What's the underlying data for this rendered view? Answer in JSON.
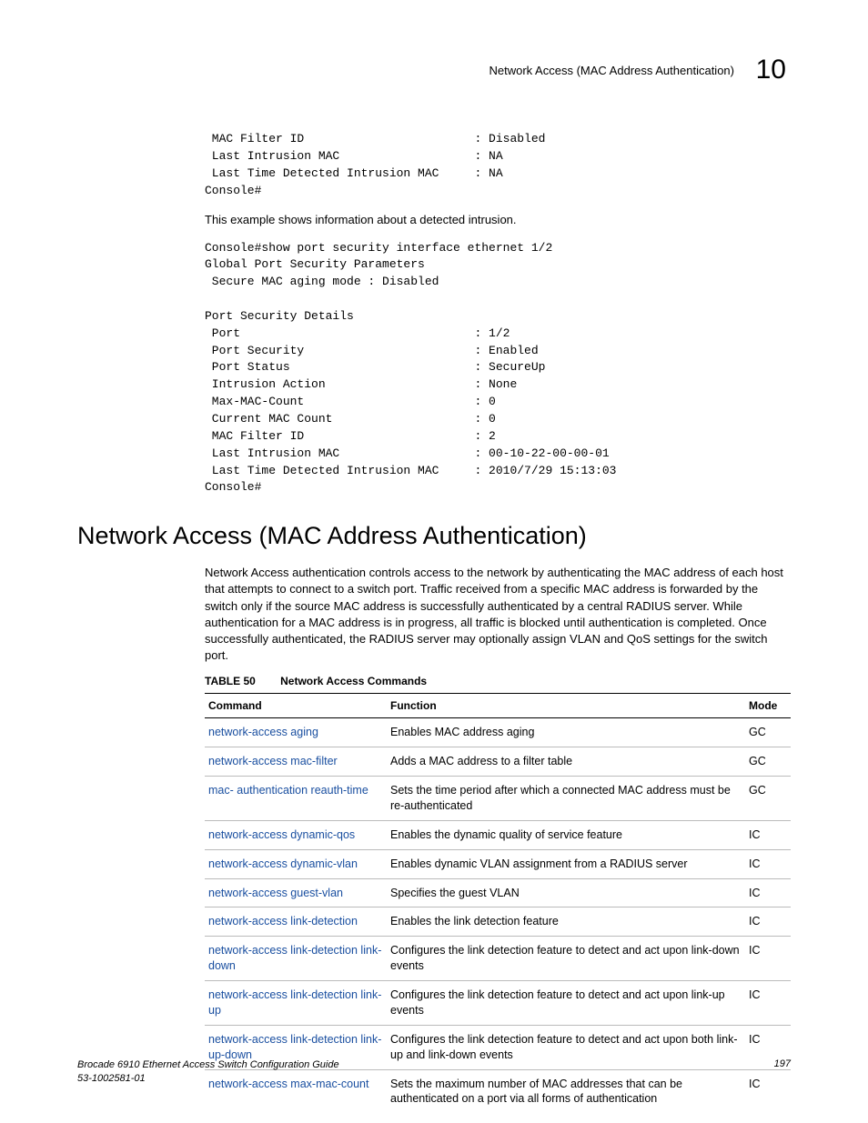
{
  "header": {
    "title": "Network Access (MAC Address Authentication)",
    "chapter_number": "10"
  },
  "code_block_1": " MAC Filter ID                        : Disabled\n Last Intrusion MAC                   : NA\n Last Time Detected Intrusion MAC     : NA\nConsole#",
  "example_intro": "This example shows information about a detected intrusion.",
  "code_block_2": "Console#show port security interface ethernet 1/2\nGlobal Port Security Parameters\n Secure MAC aging mode : Disabled\n\nPort Security Details\n Port                                 : 1/2\n Port Security                        : Enabled\n Port Status                          : SecureUp\n Intrusion Action                     : None\n Max-MAC-Count                        : 0\n Current MAC Count                    : 0\n MAC Filter ID                        : 2\n Last Intrusion MAC                   : 00-10-22-00-00-01\n Last Time Detected Intrusion MAC     : 2010/7/29 15:13:03\nConsole#",
  "section_heading": "Network Access (MAC Address Authentication)",
  "section_body": "Network Access authentication controls access to the network by authenticating the MAC address of each host that attempts to connect to a switch port. Traffic received from a specific MAC address is forwarded by the switch only if the source MAC address is successfully authenticated by a central RADIUS server. While authentication for a MAC address is in progress, all traffic is blocked until authentication is completed. Once successfully authenticated, the RADIUS server may optionally assign VLAN and QoS settings for the switch port.",
  "table": {
    "label": "TABLE 50",
    "title": "Network Access Commands",
    "headers": {
      "command": "Command",
      "function": "Function",
      "mode": "Mode"
    },
    "rows": [
      {
        "command": "network-access aging",
        "function": "Enables MAC address aging",
        "mode": "GC"
      },
      {
        "command": "network-access mac-filter",
        "function": "Adds a MAC address to a filter table",
        "mode": "GC"
      },
      {
        "command": "mac- authentication reauth-time",
        "function": "Sets the time period after which a connected MAC address must be re-authenticated",
        "mode": "GC"
      },
      {
        "command": "network-access dynamic-qos",
        "function": "Enables the dynamic quality of service feature",
        "mode": "IC"
      },
      {
        "command": "network-access dynamic-vlan",
        "function": "Enables dynamic VLAN assignment from a RADIUS server",
        "mode": "IC"
      },
      {
        "command": "network-access guest-vlan",
        "function": "Specifies the guest VLAN",
        "mode": "IC"
      },
      {
        "command": "network-access link-detection",
        "function": "Enables the link detection feature",
        "mode": "IC"
      },
      {
        "command": "network-access link-detection link-down",
        "function": "Configures the link detection feature to detect and act upon link-down events",
        "mode": "IC"
      },
      {
        "command": "network-access link-detection link-up",
        "function": "Configures the link detection feature to detect and act upon link-up events",
        "mode": "IC"
      },
      {
        "command": "network-access link-detection link-up-down",
        "function": "Configures the link detection feature to detect and act upon both link-up and link-down events",
        "mode": "IC"
      },
      {
        "command": "network-access max-mac-count",
        "function": "Sets the maximum number of MAC addresses that can be authenticated on a port via all forms of authentication",
        "mode": "IC"
      }
    ]
  },
  "footer": {
    "book_title": "Brocade 6910 Ethernet Access Switch Configuration Guide",
    "doc_number": "53-1002581-01",
    "page_number": "197"
  }
}
